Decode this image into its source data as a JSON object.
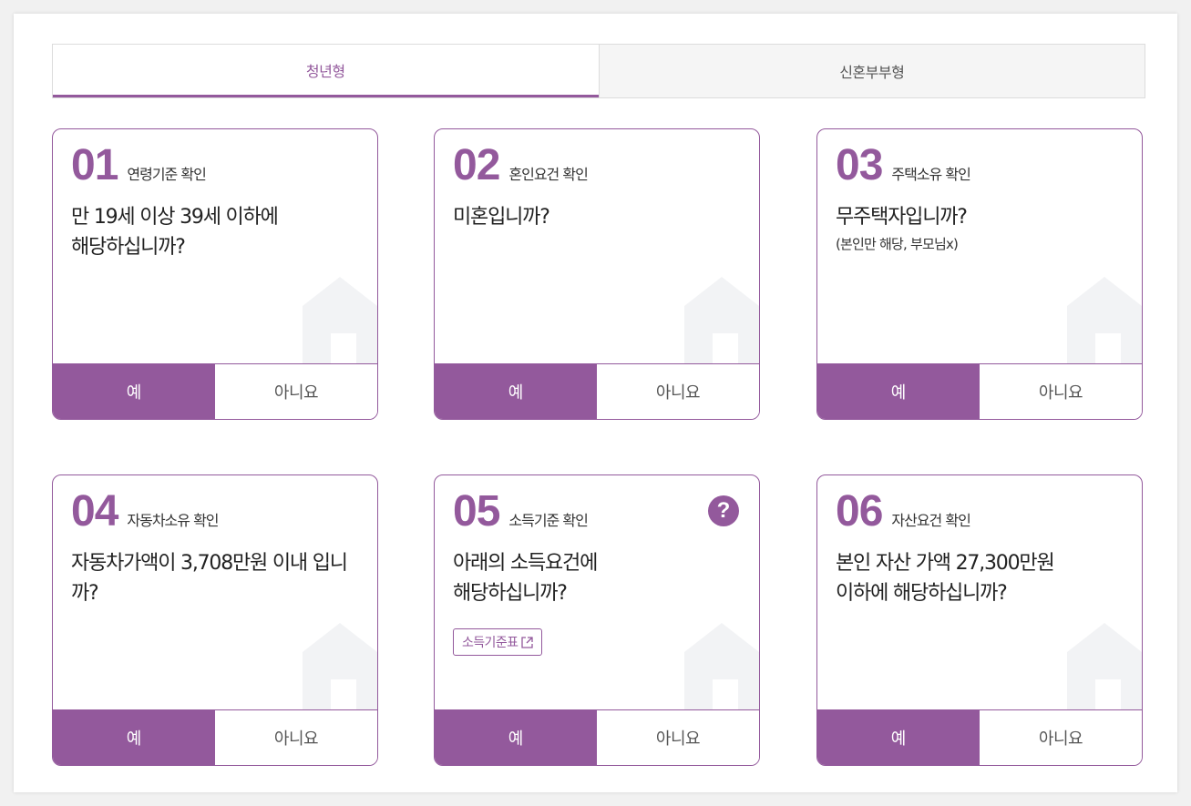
{
  "tabs": [
    {
      "label": "청년형",
      "active": true
    },
    {
      "label": "신혼부부형",
      "active": false
    }
  ],
  "cards": [
    {
      "num": "01",
      "title": "연령기준 확인",
      "question": "만 19세 이상 39세 이하에\n해당하십니까?",
      "yes": "예",
      "no": "아니요"
    },
    {
      "num": "02",
      "title": "혼인요건 확인",
      "question": "미혼입니까?",
      "yes": "예",
      "no": "아니요"
    },
    {
      "num": "03",
      "title": "주택소유 확인",
      "question": "무주택자입니까?",
      "note": "(본인만 해당, 부모님x)",
      "yes": "예",
      "no": "아니요"
    },
    {
      "num": "04",
      "title": "자동차소유 확인",
      "question": "자동차가액이 3,708만원 이내 입니까?",
      "yes": "예",
      "no": "아니요"
    },
    {
      "num": "05",
      "title": "소득기준 확인",
      "question": "아래의 소득요건에\n해당하십니까?",
      "help": "?",
      "link_label": "소득기준표",
      "yes": "예",
      "no": "아니요"
    },
    {
      "num": "06",
      "title": "자산요건 확인",
      "question": "본인 자산 가액 27,300만원\n이하에 해당하십니까?",
      "yes": "예",
      "no": "아니요"
    }
  ],
  "colors": {
    "accent": "#93599c",
    "house": "#f2f3f5"
  },
  "icons": {
    "house": "house-icon",
    "help": "question-mark-icon",
    "external": "external-link-icon"
  }
}
